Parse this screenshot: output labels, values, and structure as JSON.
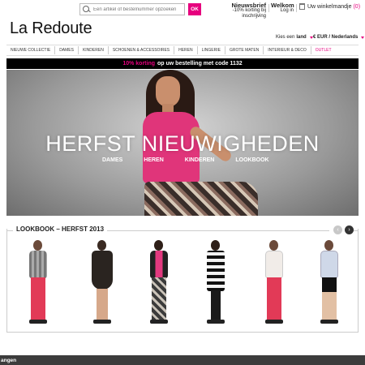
{
  "search": {
    "placeholder": "Een artikel of bestelnummer opzoeken",
    "button": "OK"
  },
  "utility": {
    "newsletter_title": "Nieuwsbrief",
    "newsletter_sub": "-10% korting bij inschrijving",
    "welcome_title": "Welkom",
    "welcome_sub": "Log in",
    "cart_label": "Uw winkelmandje",
    "cart_count": "(0)"
  },
  "brand": {
    "logo": "La Redoute",
    "accent": "#e6007e"
  },
  "locale": {
    "country_label": "Kies een",
    "country_value": "land",
    "currency": "€ EUR / Nederlands"
  },
  "nav": {
    "items": [
      "NIEUWE COLLECTIE",
      "DAMES",
      "KINDEREN",
      "SCHOENEN & ACCESSOIRES",
      "HEREN",
      "LINGERIE",
      "GROTE MATEN",
      "INTERIEUR & DECO",
      "OUTLET"
    ]
  },
  "promo": {
    "highlight": "10% korting",
    "text": "op uw bestelling met code 1132"
  },
  "hero": {
    "title": "HERFST NIEUWIGHEDEN",
    "links": [
      "DAMES",
      "HEREN",
      "KINDEREN",
      "LOOKBOOK"
    ]
  },
  "lookbook": {
    "title": "LOOKBOOK – HERFST 2013"
  },
  "bottom": {
    "text": "angen"
  }
}
